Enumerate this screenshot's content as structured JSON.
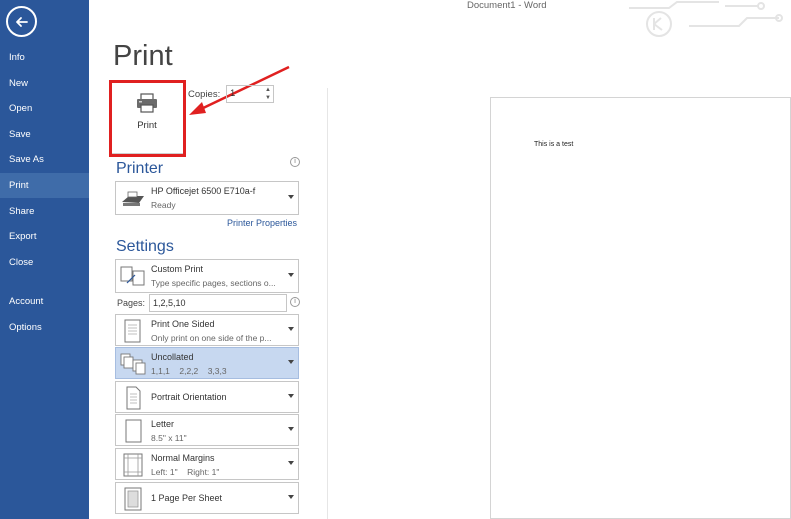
{
  "window": {
    "title": "Document1 - Word"
  },
  "sidebar": {
    "items": [
      {
        "label": "Info"
      },
      {
        "label": "New"
      },
      {
        "label": "Open"
      },
      {
        "label": "Save"
      },
      {
        "label": "Save As"
      },
      {
        "label": "Print"
      },
      {
        "label": "Share"
      },
      {
        "label": "Export"
      },
      {
        "label": "Close"
      },
      {
        "label": "Account"
      },
      {
        "label": "Options"
      }
    ],
    "active": "Print",
    "color": "#2b579a"
  },
  "print": {
    "heading": "Print",
    "button_label": "Print",
    "copies_label": "Copies:",
    "copies_value": "1"
  },
  "printer": {
    "heading": "Printer",
    "name": "HP Officejet 6500 E710a-f",
    "status": "Ready",
    "properties_link": "Printer Properties"
  },
  "settings": {
    "heading": "Settings",
    "scope": {
      "title": "Custom Print",
      "desc": "Type specific pages, sections o..."
    },
    "pages_label": "Pages:",
    "pages_value": "1,2,5,10",
    "sides": {
      "title": "Print One Sided",
      "desc": "Only print on one side of the p..."
    },
    "collation": {
      "title": "Uncollated",
      "desc": "1,1,1    2,2,2    3,3,3"
    },
    "orientation": {
      "title": "Portrait Orientation"
    },
    "paper": {
      "title": "Letter",
      "desc": "8.5\" x 11\""
    },
    "margins": {
      "title": "Normal Margins",
      "desc": "Left: 1\"    Right: 1\""
    },
    "per_sheet": {
      "title": "1 Page Per Sheet"
    }
  },
  "preview": {
    "text": "This is a test"
  },
  "info_icon": "i",
  "colors": {
    "highlight": "#e02020",
    "accent": "#2b579a"
  }
}
